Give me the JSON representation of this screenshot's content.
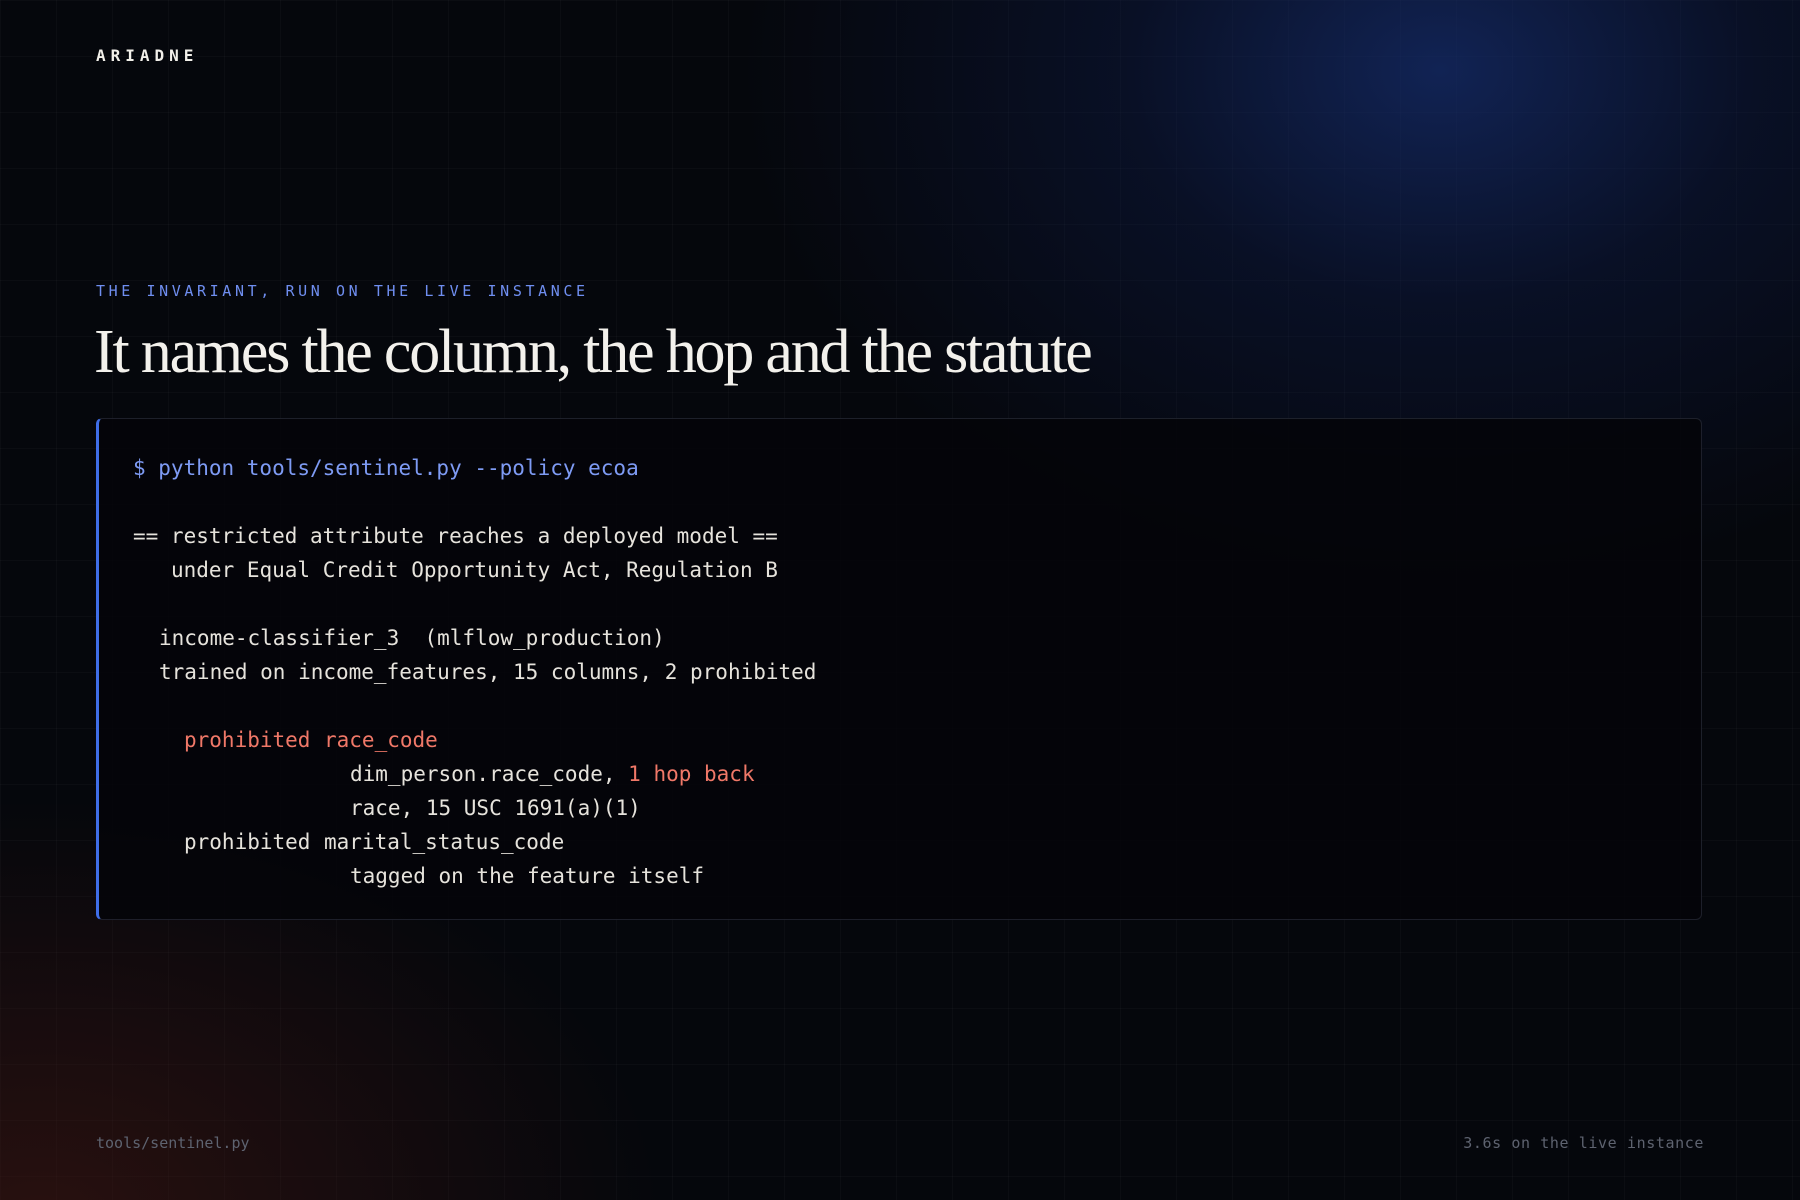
{
  "brand": "ARIADNE",
  "eyebrow": "THE INVARIANT, RUN ON THE LIVE INSTANCE",
  "headline": "It names the column, the hop and the statute",
  "terminal": {
    "command": "$ python tools/sentinel.py --policy ecoa",
    "header_line": "== restricted attribute reaches a deployed model ==",
    "header_sub": "under Equal Credit Opportunity Act, Regulation B",
    "model_line": "income-classifier_3  (mlflow_production)",
    "trained_line": "trained on income_features, 15 columns, 2 prohibited",
    "findings": [
      {
        "label": "prohibited",
        "column": "race_code",
        "lineage_prefix": "dim_person.race_code, ",
        "lineage_hop": "1 hop back",
        "statute": "race, 15 USC 1691(a)(1)"
      },
      {
        "label": "prohibited",
        "column": "marital_status_code",
        "note": "tagged on the feature itself"
      }
    ]
  },
  "footer": {
    "left": "tools/sentinel.py",
    "right": "3.6s on the live instance"
  },
  "colors": {
    "accent": "#3f6ee8",
    "prompt": "#7e9bf4",
    "alert": "#f07868"
  }
}
